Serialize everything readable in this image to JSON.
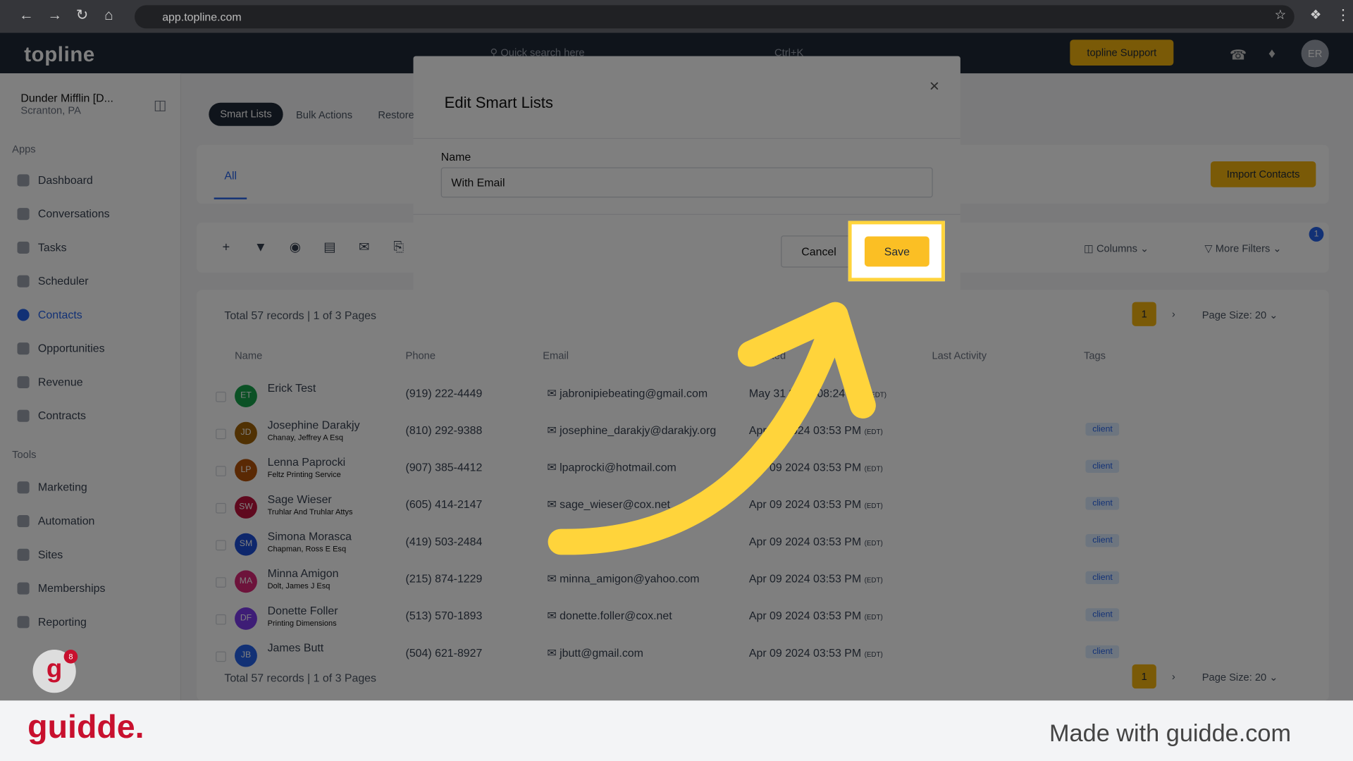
{
  "browser": {
    "url": "app.topline.com"
  },
  "app": {
    "logo": "topline",
    "search_placeholder": "Quick search here",
    "shortcut": "Ctrl+K",
    "support": "topline Support",
    "user_initials": "ER"
  },
  "location": {
    "name": "Dunder Mifflin [D...",
    "city": "Scranton, PA"
  },
  "sidebar": {
    "apps_label": "Apps",
    "tools_label": "Tools",
    "apps": [
      "Dashboard",
      "Conversations",
      "Tasks",
      "Scheduler",
      "Contacts",
      "Opportunities",
      "Revenue",
      "Contracts"
    ],
    "tools": [
      "Marketing",
      "Automation",
      "Sites",
      "Memberships",
      "Reporting"
    ]
  },
  "tabs": [
    "Smart Lists",
    "Bulk Actions",
    "Restore"
  ],
  "subtab": "All",
  "import_label": "Import Contacts",
  "columns_label": "Columns",
  "more_filters_label": "More Filters",
  "filter_count": "1",
  "records": "Total 57 records | 1 of 3 Pages",
  "page": "1",
  "page_size": "Page Size: 20",
  "headers": [
    "Name",
    "Phone",
    "Email",
    "Created",
    "Last Activity",
    "Tags"
  ],
  "rows": [
    {
      "initials": "ET",
      "color": "#16a34a",
      "name": "Erick Test",
      "company": "",
      "phone": "(919) 222-4449",
      "email": "jabronipiebeating@gmail.com",
      "date": "May 31 2024 08:24 PM",
      "tz": "(EDT)",
      "tag": ""
    },
    {
      "initials": "JD",
      "color": "#a16207",
      "name": "Josephine Darakjy",
      "company": "Chanay, Jeffrey A Esq",
      "phone": "(810) 292-9388",
      "email": "josephine_darakjy@darakjy.org",
      "date": "Apr 09 2024 03:53 PM",
      "tz": "(EDT)",
      "tag": "client"
    },
    {
      "initials": "LP",
      "color": "#b45309",
      "name": "Lenna Paprocki",
      "company": "Feltz Printing Service",
      "phone": "(907) 385-4412",
      "email": "lpaprocki@hotmail.com",
      "date": "Apr 09 2024 03:53 PM",
      "tz": "(EDT)",
      "tag": "client"
    },
    {
      "initials": "SW",
      "color": "#be123c",
      "name": "Sage Wieser",
      "company": "Truhlar And Truhlar Attys",
      "phone": "(605) 414-2147",
      "email": "sage_wieser@cox.net",
      "date": "Apr 09 2024 03:53 PM",
      "tz": "(EDT)",
      "tag": "client"
    },
    {
      "initials": "SM",
      "color": "#1d4ed8",
      "name": "Simona Morasca",
      "company": "Chapman, Ross E Esq",
      "phone": "(419) 503-2484",
      "email": "",
      "date": "Apr 09 2024 03:53 PM",
      "tz": "(EDT)",
      "tag": "client"
    },
    {
      "initials": "MA",
      "color": "#db2777",
      "name": "Minna Amigon",
      "company": "Dolt, James J Esq",
      "phone": "(215) 874-1229",
      "email": "minna_amigon@yahoo.com",
      "date": "Apr 09 2024 03:53 PM",
      "tz": "(EDT)",
      "tag": "client"
    },
    {
      "initials": "DF",
      "color": "#7c3aed",
      "name": "Donette Foller",
      "company": "Printing Dimensions",
      "phone": "(513) 570-1893",
      "email": "donette.foller@cox.net",
      "date": "Apr 09 2024 03:53 PM",
      "tz": "(EDT)",
      "tag": "client"
    },
    {
      "initials": "JB",
      "color": "#2563eb",
      "name": "James Butt",
      "company": "",
      "phone": "(504) 621-8927",
      "email": "jbutt@gmail.com",
      "date": "Apr 09 2024 03:53 PM",
      "tz": "(EDT)",
      "tag": "client"
    }
  ],
  "modal": {
    "title": "Edit Smart Lists",
    "name_label": "Name",
    "name_value": "With Email",
    "cancel": "Cancel",
    "save": "Save"
  },
  "guidde": {
    "badge": "8",
    "brand": "guidde.",
    "tagline": "Made with guidde.com"
  },
  "colors": {
    "accent": "#f5b50f",
    "highlight": "#ffd43b",
    "brand": "#c8102e"
  }
}
